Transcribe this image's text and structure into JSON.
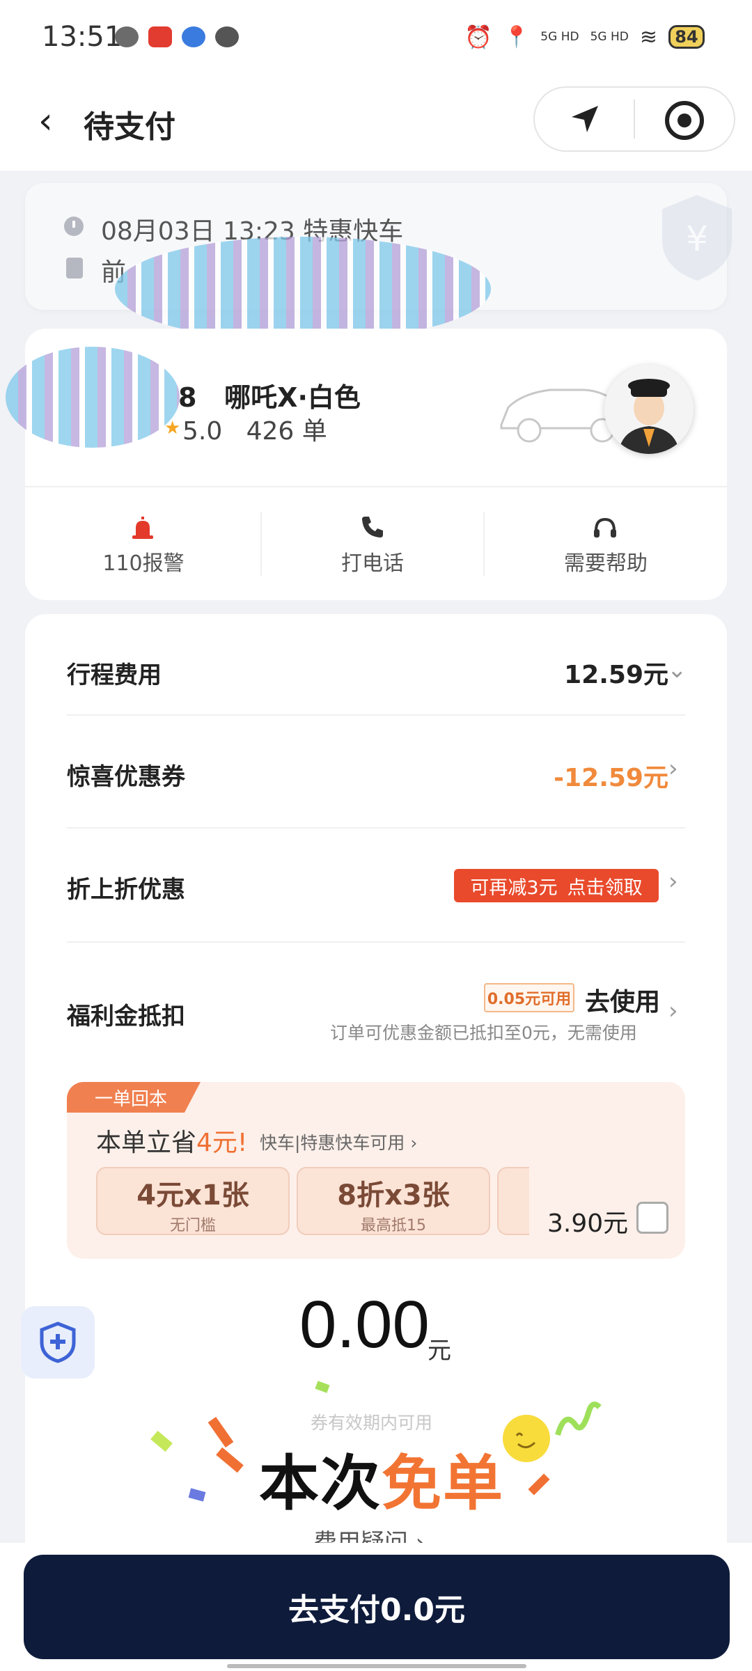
{
  "status_bar": {
    "time": "13:51",
    "network": "5G HD",
    "battery": "84"
  },
  "header": {
    "title": "待支付"
  },
  "trip": {
    "time": "08月03日 13:23 特惠快车",
    "address_prefix": "前"
  },
  "driver": {
    "plate_fragment": "8",
    "car": "哪吒X·白色",
    "rating": "5.0",
    "orders": "426 单"
  },
  "actions": [
    {
      "label": "110报警",
      "icon": "alarm-icon"
    },
    {
      "label": "打电话",
      "icon": "phone-icon"
    },
    {
      "label": "需要帮助",
      "icon": "headset-icon"
    }
  ],
  "fees": {
    "trip_fee_label": "行程费用",
    "trip_fee_value": "12.59元",
    "coupon_label": "惊喜优惠券",
    "coupon_value": "-12.59元",
    "discount_label": "折上折优惠",
    "discount_tag_left": "可再减3元",
    "discount_tag_right": "点击领取",
    "bonus_label": "福利金抵扣",
    "bonus_tag": "0.05元可用",
    "bonus_action": "去使用",
    "bonus_desc": "订单可优惠金额已抵扣至0元，无需使用"
  },
  "promo": {
    "tag": "一单回本",
    "title_prefix": "本单立省",
    "title_highlight": "4元!",
    "subtitle": "快车|特惠快车可用",
    "coupons": [
      {
        "main": "4元x1张",
        "sub": "无门槛"
      },
      {
        "main": "8折x3张",
        "sub": "最高抵15"
      }
    ],
    "price": "3.90元"
  },
  "total": {
    "amount": "0.00",
    "unit": "元"
  },
  "free_order": {
    "note": "券有效期内可用",
    "text_black": "本次",
    "text_orange": "免单"
  },
  "faq": "费用疑问 ›",
  "pay_button": "去支付0.0元",
  "colors": {
    "accent_orange": "#f07033",
    "pay_button": "#0e1b3b",
    "alert_red": "#e94a2c"
  }
}
